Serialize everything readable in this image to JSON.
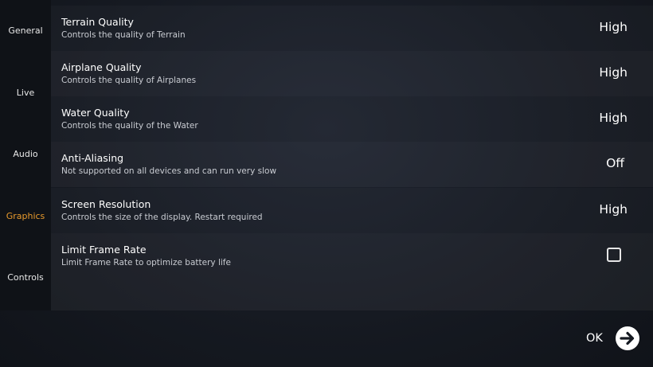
{
  "sidebar": {
    "items": [
      {
        "label": "General"
      },
      {
        "label": "Live"
      },
      {
        "label": "Audio"
      },
      {
        "label": "Graphics",
        "active": true
      },
      {
        "label": "Controls"
      }
    ]
  },
  "settings": [
    {
      "title": "Terrain Quality",
      "description": "Controls the quality of Terrain",
      "value": "High"
    },
    {
      "title": "Airplane Quality",
      "description": "Controls the quality of Airplanes",
      "value": "High"
    },
    {
      "title": "Water Quality",
      "description": "Controls the quality of the Water",
      "value": "High"
    },
    {
      "title": "Anti-Aliasing",
      "description": "Not supported on all devices and can run very slow",
      "value": "Off"
    },
    {
      "title": "Screen Resolution",
      "description": "Controls the size of the display. Restart required",
      "value": "High"
    },
    {
      "title": "Limit Frame Rate",
      "description": "Limit Frame Rate to optimize battery life",
      "checked": false
    }
  ],
  "footer": {
    "ok_label": "OK",
    "ok_icon": "arrow-right-icon"
  },
  "colors": {
    "accent": "#e89a2c",
    "background": "#161a22",
    "text": "#ffffff"
  }
}
